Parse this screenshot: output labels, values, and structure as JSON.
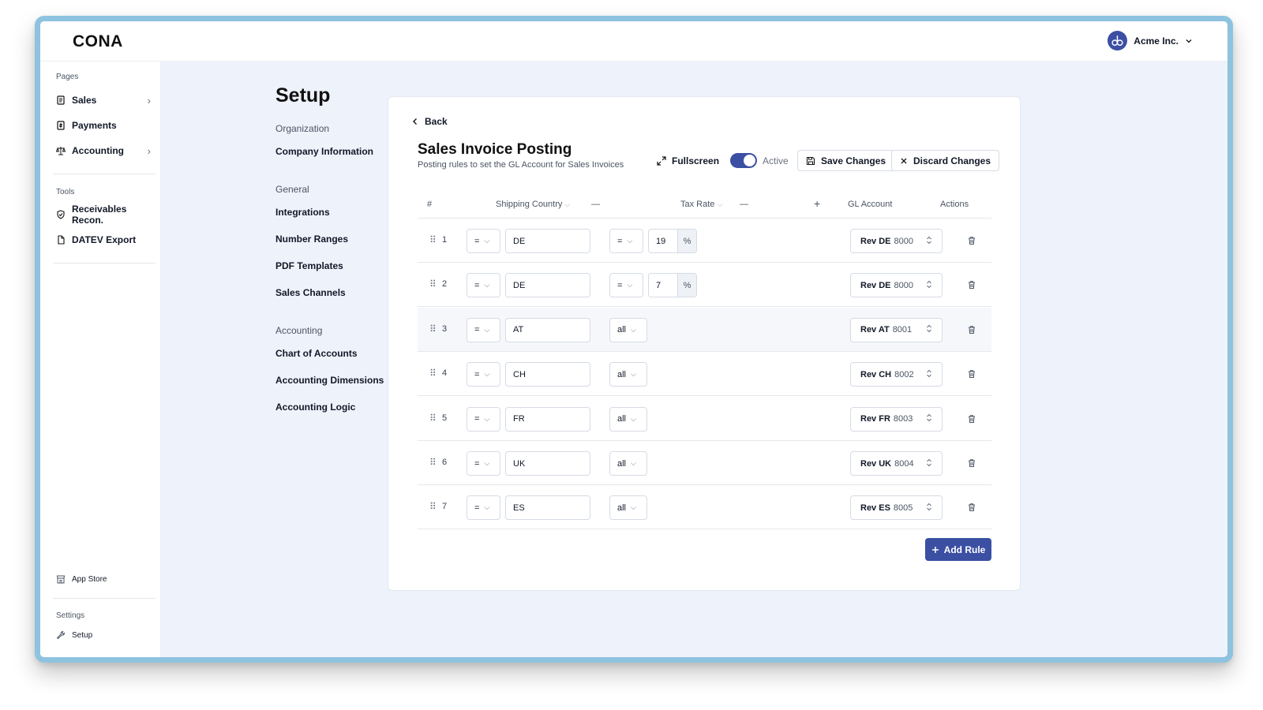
{
  "app": {
    "logo": "CONA",
    "company": "Acme Inc."
  },
  "sidebar": {
    "pages_label": "Pages",
    "pages": [
      {
        "label": "Sales",
        "has_chevron": true
      },
      {
        "label": "Payments",
        "has_chevron": false
      },
      {
        "label": "Accounting",
        "has_chevron": true
      }
    ],
    "tools_label": "Tools",
    "tools": [
      {
        "label": "Receivables Recon."
      },
      {
        "label": "DATEV Export"
      }
    ],
    "app_store": "App Store",
    "settings_label": "Settings",
    "setup": "Setup"
  },
  "setup_nav": {
    "title": "Setup",
    "sections": [
      {
        "heading": "Organization",
        "links": [
          "Company Information"
        ]
      },
      {
        "heading": "General",
        "links": [
          "Integrations",
          "Number Ranges",
          "PDF Templates",
          "Sales Channels"
        ]
      },
      {
        "heading": "Accounting",
        "links": [
          "Chart of Accounts",
          "Accounting Dimensions",
          "Accounting Logic"
        ]
      }
    ]
  },
  "card": {
    "back": "Back",
    "title": "Sales Invoice Posting",
    "subtitle": "Posting rules to set the GL Account for Sales Invoices",
    "fullscreen": "Fullscreen",
    "active_label": "Active",
    "active": true,
    "save": "Save Changes",
    "discard": "Discard Changes",
    "columns": {
      "num": "#",
      "country": "Shipping Country",
      "tax": "Tax Rate",
      "gl": "GL Account",
      "actions": "Actions",
      "minus": "—",
      "plus": "+"
    },
    "rules": [
      {
        "n": "1",
        "op": "=",
        "country": "DE",
        "tax_op": "=",
        "tax": "19",
        "unit": "%",
        "gl_name": "Rev DE",
        "gl_code": "8000"
      },
      {
        "n": "2",
        "op": "=",
        "country": "DE",
        "tax_op": "=",
        "tax": "7",
        "unit": "%",
        "gl_name": "Rev DE",
        "gl_code": "8000"
      },
      {
        "n": "3",
        "op": "=",
        "country": "AT",
        "tax_op": "all",
        "gl_name": "Rev AT",
        "gl_code": "8001",
        "highlighted": true
      },
      {
        "n": "4",
        "op": "=",
        "country": "CH",
        "tax_op": "all",
        "gl_name": "Rev CH",
        "gl_code": "8002"
      },
      {
        "n": "5",
        "op": "=",
        "country": "FR",
        "tax_op": "all",
        "gl_name": "Rev FR",
        "gl_code": "8003"
      },
      {
        "n": "6",
        "op": "=",
        "country": "UK",
        "tax_op": "all",
        "gl_name": "Rev UK",
        "gl_code": "8004"
      },
      {
        "n": "7",
        "op": "=",
        "country": "ES",
        "tax_op": "all",
        "gl_name": "Rev ES",
        "gl_code": "8005"
      }
    ],
    "add_rule": "Add Rule"
  },
  "colors": {
    "accent": "#3b4fa3",
    "frame": "#8ec3df",
    "background": "#eef2fb"
  }
}
